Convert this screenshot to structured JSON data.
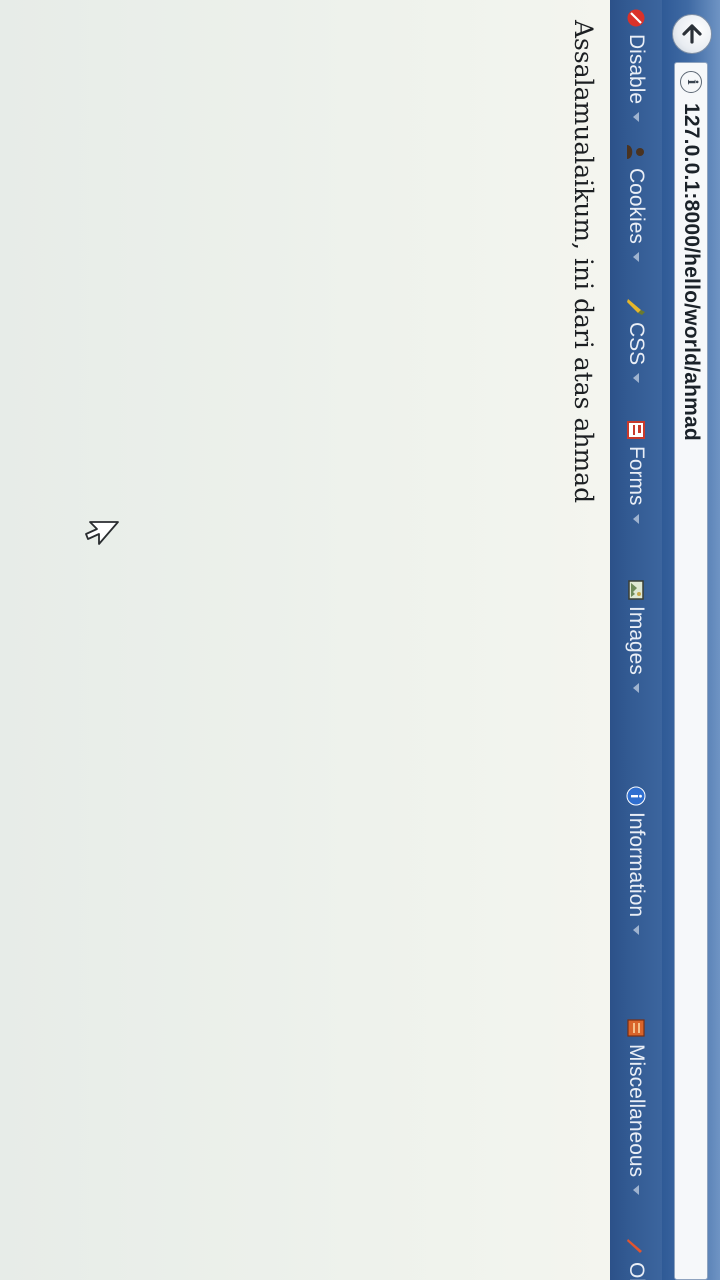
{
  "browser": {
    "url": "127.0.0.1:8000/hello/world/ahmad",
    "info_icon_glyph": "i"
  },
  "toolbar": {
    "items": [
      {
        "label": "Disable",
        "icon": "disable-icon",
        "icon_color": "#d9322a"
      },
      {
        "label": "Cookies",
        "icon": "cookies-icon",
        "icon_color": "#6b4a2a"
      },
      {
        "label": "CSS",
        "icon": "css-icon",
        "icon_color": "#e5b62b"
      },
      {
        "label": "Forms",
        "icon": "forms-icon",
        "icon_color": "#c83a2c"
      },
      {
        "label": "Images",
        "icon": "images-icon",
        "icon_color": "#6e8a5a"
      },
      {
        "label": "Information",
        "icon": "information-icon",
        "icon_color": "#2f6fd0"
      },
      {
        "label": "Miscellaneous",
        "icon": "miscellaneous-icon",
        "icon_color": "#d9642a"
      },
      {
        "label": "Ol",
        "icon": "outline-icon",
        "icon_color": "#e2552f"
      }
    ]
  },
  "page": {
    "greeting": "Assalamualaikum, ini dari atas ahmad"
  },
  "colors": {
    "toolbar_bg": "#335b93",
    "page_bg": "#eef2ec",
    "text": "#1c1f22"
  }
}
